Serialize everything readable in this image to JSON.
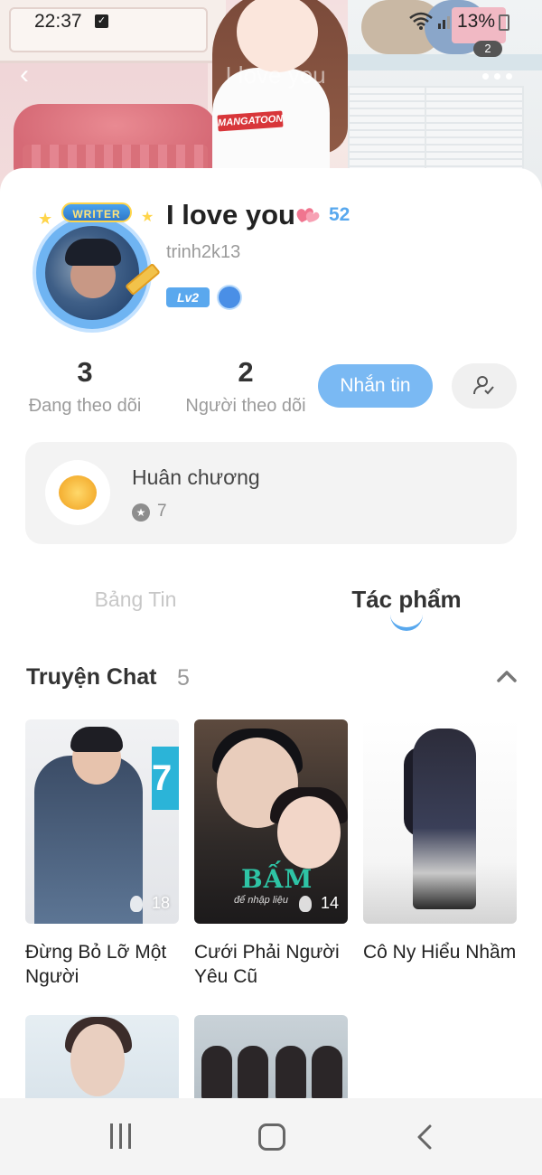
{
  "status_bar": {
    "time": "22:37",
    "battery": "13%"
  },
  "nav": {
    "title": "I love you",
    "notification_count": "2"
  },
  "banner": {
    "shirt_text": "MANGATOON"
  },
  "profile": {
    "writer_badge": "WRITER",
    "name": "I love you",
    "like_count": "52",
    "username": "trinh2k13",
    "level": "Lv2"
  },
  "stats": {
    "following_count": "3",
    "following_label": "Đang theo dõi",
    "followers_count": "2",
    "followers_label": "Người theo dõi",
    "message_button": "Nhắn tin"
  },
  "medal": {
    "title": "Huân chương",
    "count": "7"
  },
  "tabs": {
    "feed": "Bảng Tin",
    "works": "Tác phẩm",
    "active": "works"
  },
  "section": {
    "title": "Truyện Chat",
    "count": "5"
  },
  "stories": [
    {
      "title": "Đừng Bỏ Lỡ Một Người",
      "reads": "18"
    },
    {
      "title": "Cưới Phải Người Yêu Cũ",
      "reads": "14",
      "cover_text": "BẤM",
      "cover_subtext": "để nhập liệu"
    },
    {
      "title": "Cô Ny Hiểu Nhầm"
    },
    {
      "title": ""
    },
    {
      "title": ""
    }
  ],
  "colors": {
    "accent": "#58a8ee",
    "message_button": "#7ab9f3"
  },
  "icons": [
    "back-icon",
    "more-icon",
    "heart-icon",
    "vip-icon",
    "follow-status-icon",
    "medal-icon",
    "star-icon",
    "chevron-up-icon",
    "flame-icon",
    "recent-apps-icon",
    "home-icon",
    "back-nav-icon"
  ]
}
